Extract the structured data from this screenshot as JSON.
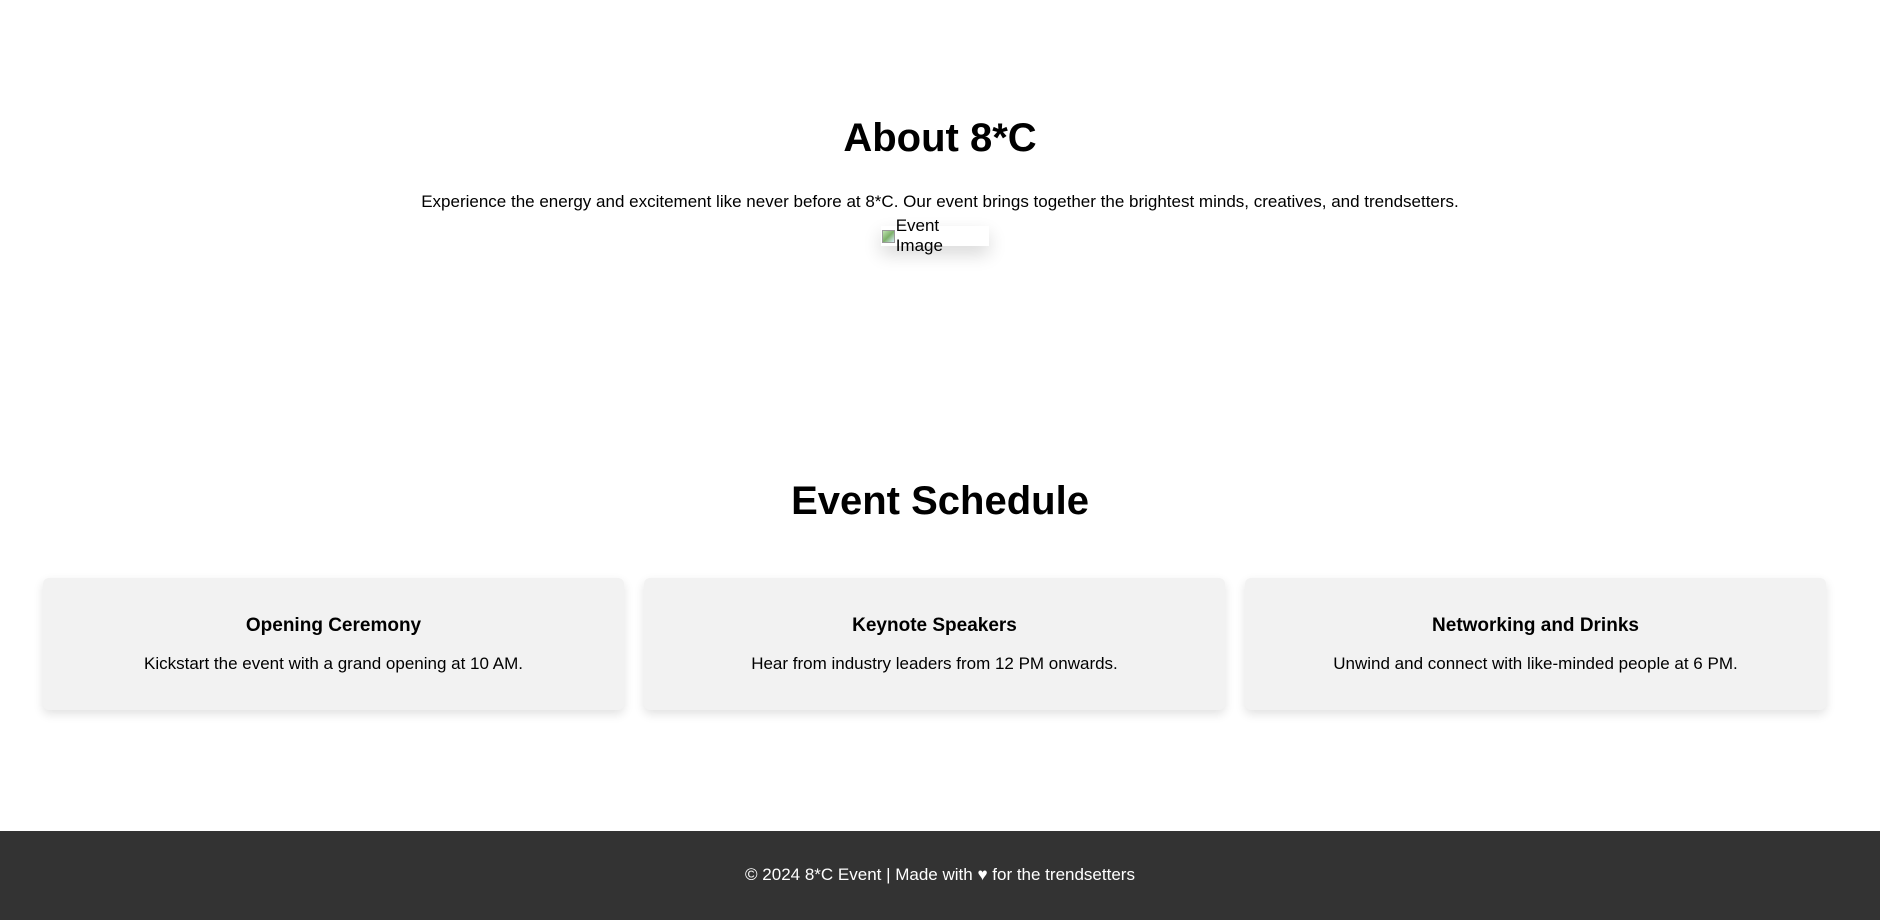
{
  "about": {
    "title": "About 8*C",
    "description": "Experience the energy and excitement like never before at 8*C. Our event brings together the brightest minds, creatives, and trendsetters.",
    "image_alt": "Event Image"
  },
  "schedule": {
    "title": "Event Schedule",
    "items": [
      {
        "title": "Opening Ceremony",
        "description": "Kickstart the event with a grand opening at 10 AM."
      },
      {
        "title": "Keynote Speakers",
        "description": "Hear from industry leaders from 12 PM onwards."
      },
      {
        "title": "Networking and Drinks",
        "description": "Unwind and connect with like-minded people at 6 PM."
      }
    ]
  },
  "footer": {
    "text": "© 2024 8*C Event | Made with ♥ for the trendsetters"
  },
  "colors": {
    "background": "#ffffff",
    "card_background": "#f2f2f2",
    "footer_background": "#333333",
    "footer_text": "#ffffff"
  }
}
